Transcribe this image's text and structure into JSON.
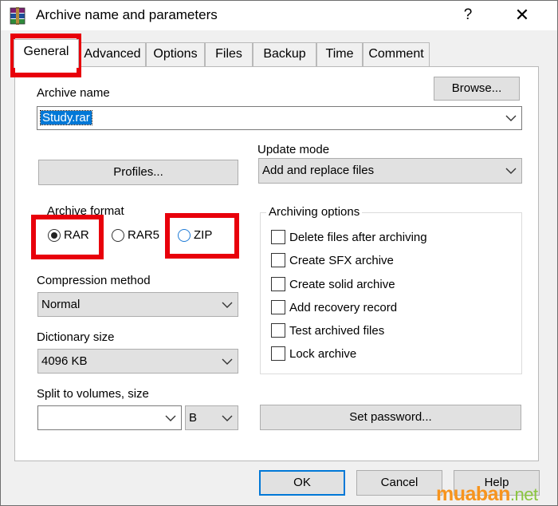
{
  "window": {
    "title": "Archive name and parameters",
    "help_glyph": "?",
    "close_glyph": "✕"
  },
  "tabs": [
    {
      "label": "General",
      "active": true
    },
    {
      "label": "Advanced"
    },
    {
      "label": "Options"
    },
    {
      "label": "Files"
    },
    {
      "label": "Backup"
    },
    {
      "label": "Time"
    },
    {
      "label": "Comment"
    }
  ],
  "archive_name": {
    "label": "Archive name",
    "value": "Study.rar",
    "browse_label": "Browse..."
  },
  "profiles_label": "Profiles...",
  "update_mode": {
    "label": "Update mode",
    "value": "Add and replace files"
  },
  "archive_format": {
    "label": "Archive format",
    "options": [
      {
        "label": "RAR",
        "selected": true
      },
      {
        "label": "RAR5"
      },
      {
        "label": "ZIP"
      }
    ]
  },
  "compression_method": {
    "label": "Compression method",
    "value": "Normal"
  },
  "dictionary_size": {
    "label": "Dictionary size",
    "value": "4096 KB"
  },
  "split": {
    "label": "Split to volumes, size",
    "value": "",
    "unit": "B"
  },
  "archiving_options": {
    "label": "Archiving options",
    "items": [
      {
        "label": "Delete files after archiving",
        "checked": false
      },
      {
        "label": "Create SFX archive",
        "checked": false
      },
      {
        "label": "Create solid archive",
        "checked": false
      },
      {
        "label": "Add recovery record",
        "checked": false
      },
      {
        "label": "Test archived files",
        "checked": false
      },
      {
        "label": "Lock archive",
        "checked": false
      }
    ]
  },
  "set_password_label": "Set password...",
  "footer": {
    "ok_label": "OK",
    "cancel_label": "Cancel",
    "help_label": "Help"
  },
  "watermark": {
    "part1": "muaban",
    "part2": ".net"
  },
  "colors": {
    "highlight_red": "#e8000b",
    "selection_blue": "#0078d7",
    "watermark_orange": "#f7941d",
    "watermark_green": "#8ac53f"
  }
}
